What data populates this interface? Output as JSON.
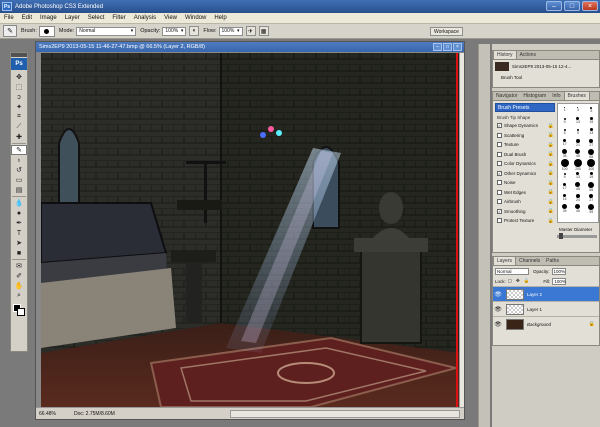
{
  "window": {
    "title": "Adobe Photoshop CS3 Extended",
    "logo": "Ps"
  },
  "menu": [
    "File",
    "Edit",
    "Image",
    "Layer",
    "Select",
    "Filter",
    "Analysis",
    "View",
    "Window",
    "Help"
  ],
  "options": {
    "brush_label": "Brush:",
    "mode_label": "Mode:",
    "mode_value": "Normal",
    "opacity_label": "Opacity:",
    "opacity_value": "100%",
    "flow_label": "Flow:",
    "flow_value": "100%",
    "workspace": "Workspace"
  },
  "toolbox": {
    "logo": "Ps",
    "tools": [
      {
        "name": "move-tool",
        "glyph": "✥"
      },
      {
        "name": "marquee-tool",
        "glyph": "⬚"
      },
      {
        "name": "lasso-tool",
        "glyph": "ↄ"
      },
      {
        "name": "magic-wand-tool",
        "glyph": "✦"
      },
      {
        "name": "crop-tool",
        "glyph": "⌗"
      },
      {
        "name": "slice-tool",
        "glyph": "⟋"
      },
      {
        "name": "healing-tool",
        "glyph": "✚"
      },
      {
        "name": "brush-tool",
        "glyph": "✎"
      },
      {
        "name": "clone-stamp-tool",
        "glyph": "♁"
      },
      {
        "name": "history-brush-tool",
        "glyph": "↺"
      },
      {
        "name": "eraser-tool",
        "glyph": "▭"
      },
      {
        "name": "gradient-tool",
        "glyph": "▤"
      },
      {
        "name": "blur-tool",
        "glyph": "💧"
      },
      {
        "name": "dodge-tool",
        "glyph": "●"
      },
      {
        "name": "pen-tool",
        "glyph": "✒"
      },
      {
        "name": "type-tool",
        "glyph": "T"
      },
      {
        "name": "path-selection-tool",
        "glyph": "➤"
      },
      {
        "name": "shape-tool",
        "glyph": "■"
      },
      {
        "name": "notes-tool",
        "glyph": "✉"
      },
      {
        "name": "eyedropper-tool",
        "glyph": "✐"
      },
      {
        "name": "hand-tool",
        "glyph": "✋"
      },
      {
        "name": "zoom-tool",
        "glyph": "⌕"
      }
    ]
  },
  "document": {
    "title": "Sims2EP9 2013-05-15 11-46-27-47.bmp @ 66.5% (Layer 2, RGB/8)",
    "zoom": "66.48%",
    "doc_size": "Doc: 2.75M/8.60M"
  },
  "history": {
    "tabs": [
      "History",
      "Actions"
    ],
    "snapshot": "Sims2EP9 2013-05-15 12-4...",
    "step": "Brush Tool"
  },
  "brushes": {
    "tabs": [
      "Navigator",
      "Histogram",
      "Info",
      "Brushes"
    ],
    "presets_label": "Brush Presets",
    "tip_shape": "Brush Tip Shape",
    "options": [
      {
        "label": "Shape Dynamics",
        "checked": "✓"
      },
      {
        "label": "Scattering",
        "checked": ""
      },
      {
        "label": "Texture",
        "checked": ""
      },
      {
        "label": "Dual Brush",
        "checked": ""
      },
      {
        "label": "Color Dynamics",
        "checked": ""
      },
      {
        "label": "Other Dynamics",
        "checked": "✓"
      },
      {
        "label": "Noise",
        "checked": ""
      },
      {
        "label": "Wet Edges",
        "checked": ""
      },
      {
        "label": "Airbrush",
        "checked": ""
      },
      {
        "label": "Smoothing",
        "checked": "✓"
      },
      {
        "label": "Protect Texture",
        "checked": ""
      }
    ],
    "sizes": [
      "1",
      "3",
      "5",
      "9",
      "13",
      "19",
      "5",
      "9",
      "13",
      "17",
      "21",
      "27",
      "35",
      "45",
      "65",
      "100",
      "200",
      "300",
      "9",
      "13",
      "19",
      "17",
      "45",
      "65",
      "14",
      "24",
      "27",
      "39",
      "46",
      "59"
    ],
    "diameter_label": "Master Diameter"
  },
  "layers": {
    "tabs": [
      "Layers",
      "Channels",
      "Paths"
    ],
    "blend_mode": "Normal",
    "opacity_label": "Opacity:",
    "opacity_value": "100%",
    "lock_label": "Lock:",
    "fill_label": "Fill:",
    "fill_value": "100%",
    "items": [
      {
        "name": "Layer 2",
        "selected": true,
        "type": "transparent"
      },
      {
        "name": "Layer 1",
        "selected": false,
        "type": "transparent"
      },
      {
        "name": "Background",
        "selected": false,
        "type": "background"
      }
    ]
  }
}
